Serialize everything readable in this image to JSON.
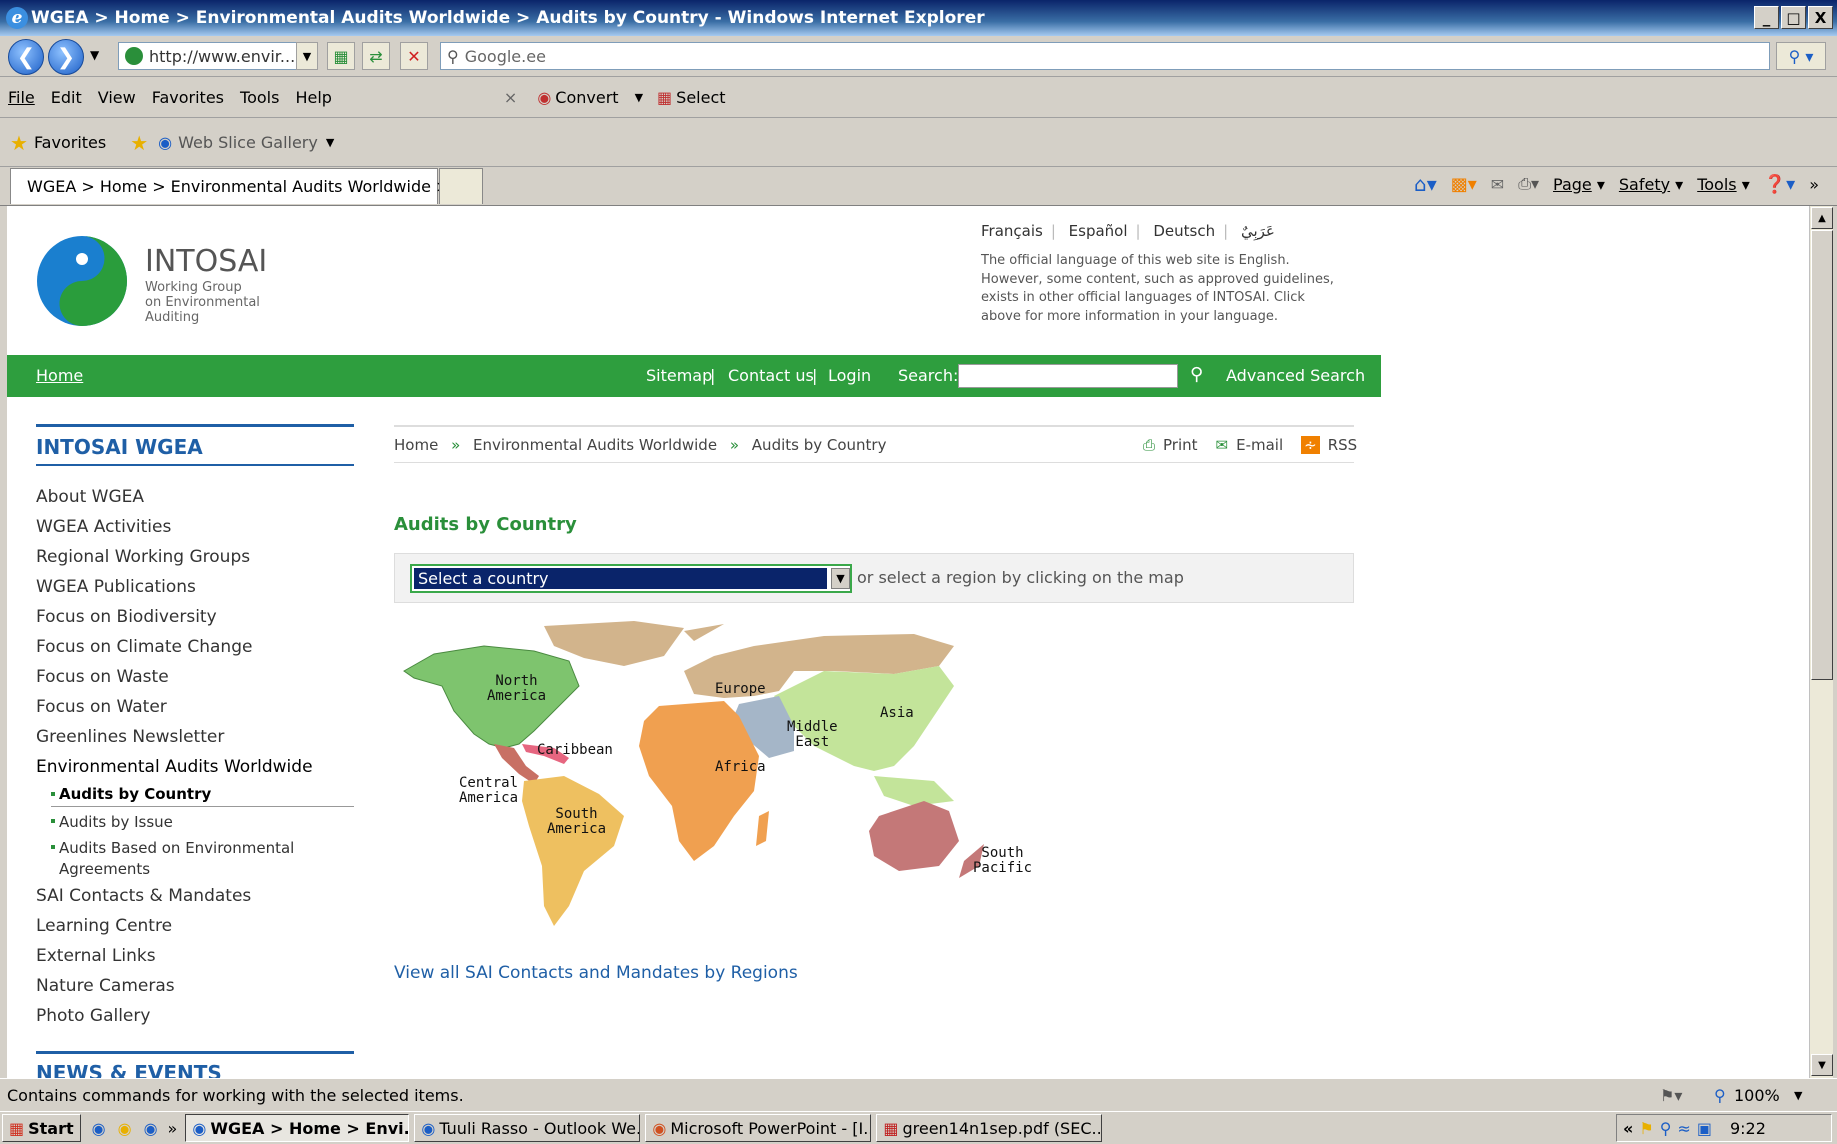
{
  "window": {
    "title": "WGEA > Home > Environmental Audits Worldwide > Audits by Country - Windows Internet Explorer",
    "min": "_",
    "max": "□",
    "close": "X"
  },
  "address": {
    "url": "http://www.envir...",
    "search_placeholder": "Google.ee"
  },
  "menu": [
    "File",
    "Edit",
    "View",
    "Favorites",
    "Tools",
    "Help"
  ],
  "convert": {
    "close": "×",
    "convert": "Convert",
    "select": "Select"
  },
  "favorites": {
    "label": "Favorites",
    "web_slice": "Web Slice Gallery"
  },
  "tab": {
    "title": "WGEA > Home > Environmental Audits Worldwide > ..."
  },
  "commandbar": {
    "page": "Page",
    "safety": "Safety",
    "tools": "Tools",
    "more": "»"
  },
  "site": {
    "logo_title": "INTOSAI",
    "logo_sub": [
      "Working Group",
      "on Environmental",
      "Auditing"
    ],
    "languages": [
      "Français",
      "Español",
      "Deutsch",
      "عَرَبِيٌ"
    ],
    "lang_note": [
      "The official language of this web site is English.",
      "However, some content, such as approved guidelines,",
      "exists in other official languages of INTOSAI. Click",
      "above for more information in your language."
    ],
    "green_bar": {
      "home": "Home",
      "sitemap": "Sitemap",
      "contact": "Contact us",
      "login": "Login",
      "search_label": "Search:",
      "advanced": "Advanced Search",
      "sep": "|"
    },
    "sidebar_title": "INTOSAI WGEA",
    "nav": [
      "About WGEA",
      "WGEA Activities",
      "Regional Working Groups",
      "WGEA Publications",
      "Focus on Biodiversity",
      "Focus on Climate Change",
      "Focus on Waste",
      "Focus on Water",
      "Greenlines Newsletter",
      "Environmental Audits Worldwide"
    ],
    "subnav": [
      "Audits by Country",
      "Audits by Issue",
      "Audits Based on Environmental",
      "Agreements"
    ],
    "nav2": [
      "SAI Contacts & Mandates",
      "Learning Centre",
      "External Links",
      "Nature Cameras",
      "Photo Gallery"
    ],
    "news_title": "NEWS & EVENTS",
    "breadcrumb": [
      "Home",
      "»",
      "Environmental Audits Worldwide",
      "»",
      "Audits by Country"
    ],
    "tools": {
      "print": "Print",
      "email": "E-mail",
      "rss": "RSS"
    },
    "heading": "Audits by Country",
    "select_value": "Select a country",
    "select_hint": "or select a region by clicking on the map",
    "regions": {
      "north_america": [
        "North",
        "America"
      ],
      "europe": "Europe",
      "asia": "Asia",
      "middle_east": [
        "Middle",
        "East"
      ],
      "caribbean": "Caribbean",
      "africa": "Africa",
      "central_america": [
        "Central",
        "America"
      ],
      "south_america": [
        "South",
        "America"
      ],
      "south_pacific": [
        "South",
        "Pacific"
      ]
    },
    "view_all": "View all SAI Contacts and Mandates by Regions"
  },
  "status": {
    "text": "Contains commands for working with the selected items.",
    "zoom": "100%"
  },
  "taskbar": {
    "start": "Start",
    "items": [
      "WGEA > Home > Envi...",
      "Tuuli Rasso - Outlook We...",
      "Microsoft PowerPoint - [I...",
      "green14n1sep.pdf (SEC..."
    ],
    "time": "9:22",
    "chev": "«",
    "more": "»"
  }
}
